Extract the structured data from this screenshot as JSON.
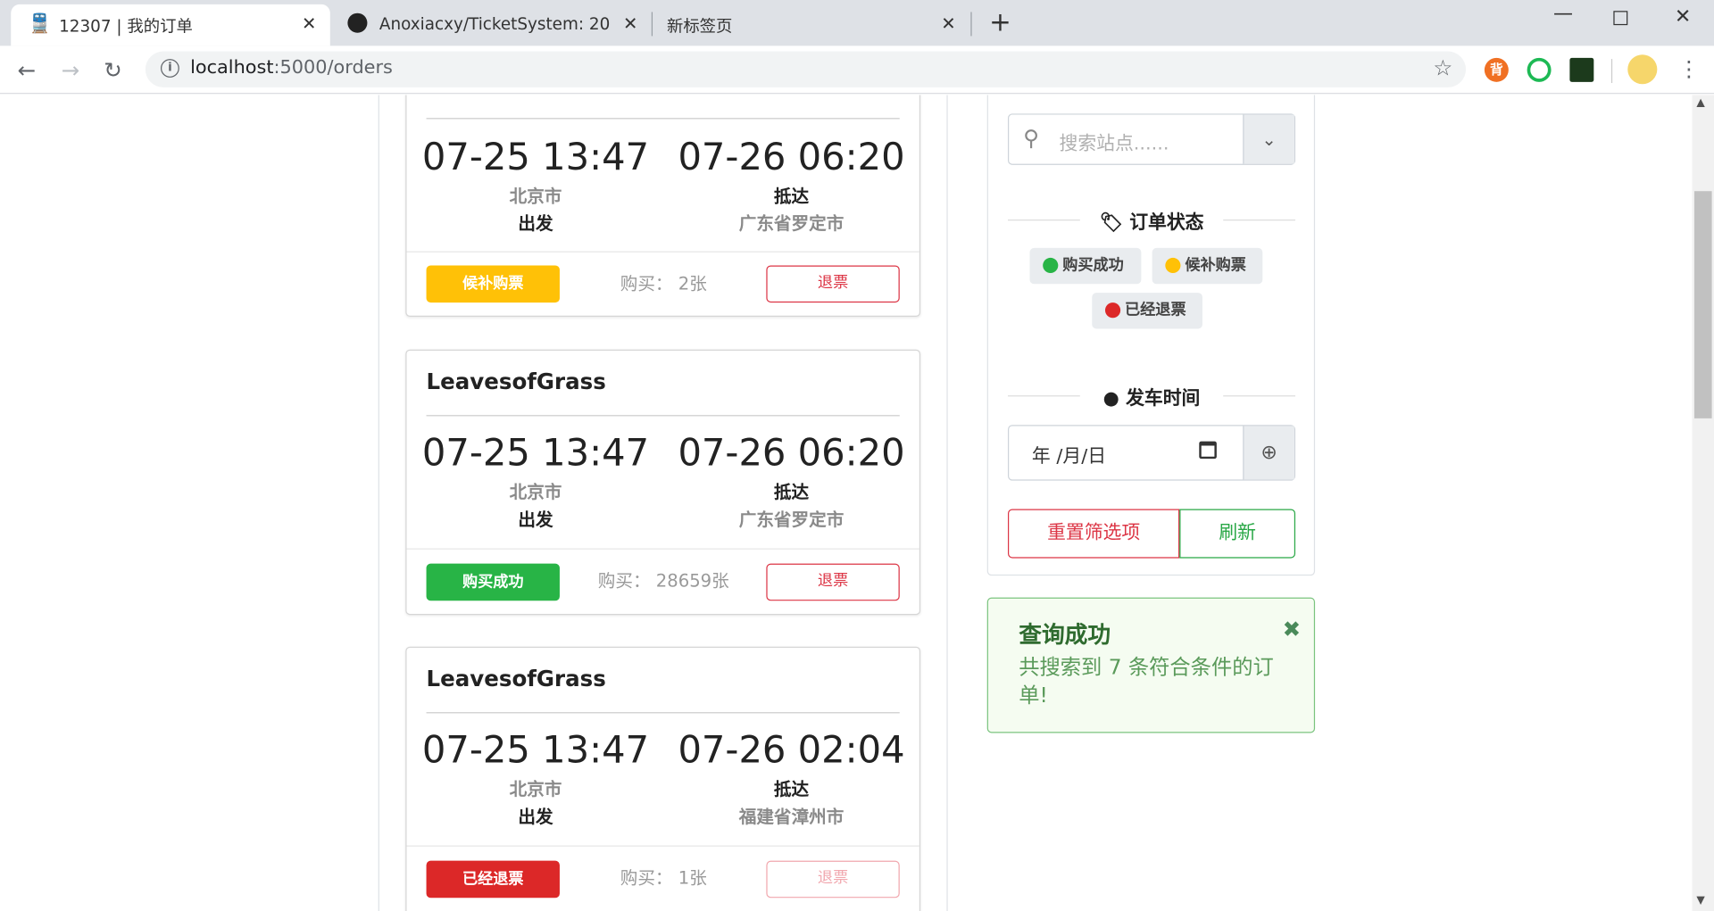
{
  "browser": {
    "tabs": [
      {
        "title": "12307 | 我的订单"
      },
      {
        "title": "Anoxiacxy/TicketSystem: 2020"
      },
      {
        "title": "新标签页"
      }
    ],
    "url_host": "localhost",
    "url_rest": ":5000/orders",
    "extensions": {
      "ext1_label": "背"
    }
  },
  "orders": [
    {
      "name": "",
      "depart_time": "07-25 13:47",
      "arrive_time": "07-26 06:20",
      "from_city": "北京市",
      "depart_label": "出发",
      "arrive_label": "抵达",
      "to_city": "广东省罗定市",
      "status": "候补购票",
      "status_color": "#ffc107",
      "buy": "购买： 2张",
      "refund": "退票"
    },
    {
      "name": "LeavesofGrass",
      "depart_time": "07-25 13:47",
      "arrive_time": "07-26 06:20",
      "from_city": "北京市",
      "depart_label": "出发",
      "arrive_label": "抵达",
      "to_city": "广东省罗定市",
      "status": "购买成功",
      "status_color": "#28b446",
      "buy": "购买： 28659张",
      "refund": "退票"
    },
    {
      "name": "LeavesofGrass",
      "depart_time": "07-25 13:47",
      "arrive_time": "07-26 02:04",
      "from_city": "北京市",
      "depart_label": "出发",
      "arrive_label": "抵达",
      "to_city": "福建省漳州市",
      "status": "已经退票",
      "status_color": "#dc2828",
      "buy": "购买： 1张",
      "refund": "退票"
    }
  ],
  "sidebar": {
    "search_placeholder": "搜索站点......",
    "status_title": "订单状态",
    "chips": [
      {
        "label": "购买成功",
        "color": "#28b446"
      },
      {
        "label": "候补购票",
        "color": "#ffc107"
      },
      {
        "label": "已经退票",
        "color": "#dc2828"
      }
    ],
    "time_title": "发车时间",
    "date_value": "年 /月/日",
    "reset_label": "重置筛选项",
    "refresh_label": "刷新"
  },
  "alert": {
    "title": "查询成功",
    "message": "共搜索到 7 条符合条件的订单!",
    "close": "✖"
  }
}
